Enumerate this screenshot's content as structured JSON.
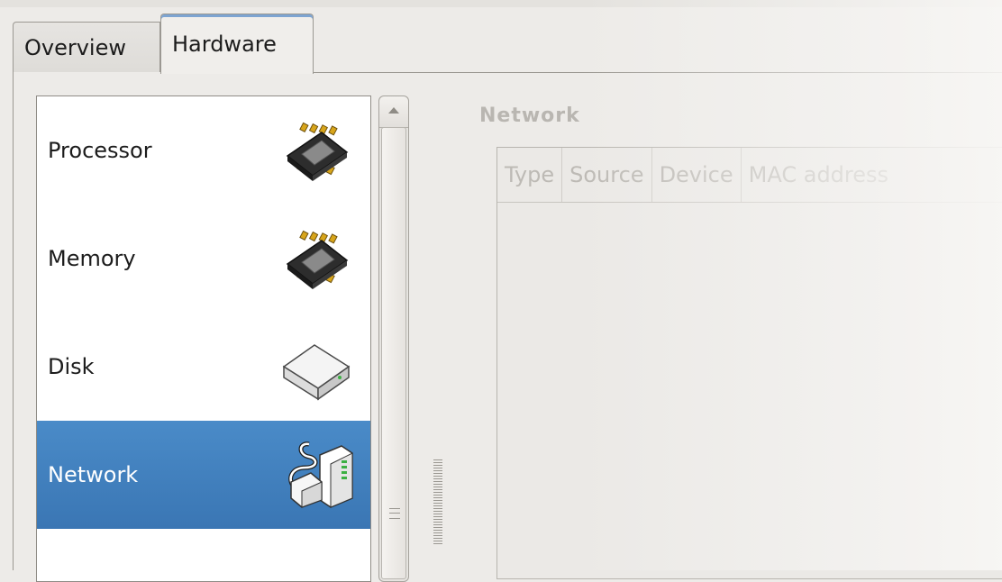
{
  "tabs": [
    {
      "label": "Overview",
      "active": false
    },
    {
      "label": "Hardware",
      "active": true
    }
  ],
  "hardware_list": {
    "items": [
      {
        "label": "Processor",
        "icon": "processor-chip-icon",
        "selected": false
      },
      {
        "label": "Memory",
        "icon": "memory-chip-icon",
        "selected": false
      },
      {
        "label": "Disk",
        "icon": "disk-drive-icon",
        "selected": false
      },
      {
        "label": "Network",
        "icon": "network-adapter-icon",
        "selected": true
      }
    ]
  },
  "detail": {
    "title": "Network",
    "columns": [
      "Type",
      "Source",
      "Device",
      "MAC address"
    ]
  },
  "colors": {
    "selection": "#3a76b4",
    "tab_accent": "#7da4d1",
    "window_bg": "#edebe8"
  }
}
